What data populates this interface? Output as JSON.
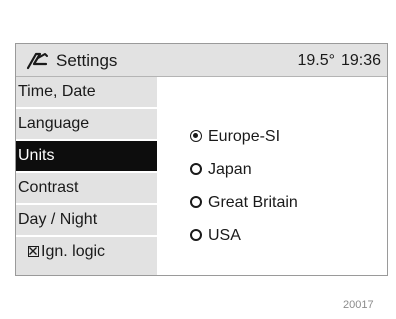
{
  "header": {
    "title": "Settings",
    "temperature": "19.5°",
    "time": "19:36",
    "logo_icon": "settings-logo-icon"
  },
  "sidebar": {
    "items": [
      {
        "label": "Time, Date",
        "selected": false
      },
      {
        "label": "Language",
        "selected": false
      },
      {
        "label": "Units",
        "selected": true
      },
      {
        "label": "Contrast",
        "selected": false
      },
      {
        "label": "Day / Night",
        "selected": false
      },
      {
        "label": "Ign. logic",
        "selected": false,
        "checkbox": true,
        "checked": true
      }
    ]
  },
  "units": {
    "options": [
      {
        "label": "Europe-SI",
        "selected": true
      },
      {
        "label": "Japan",
        "selected": false
      },
      {
        "label": "Great Britain",
        "selected": false
      },
      {
        "label": "USA",
        "selected": false
      }
    ]
  },
  "figure_number": "20017"
}
